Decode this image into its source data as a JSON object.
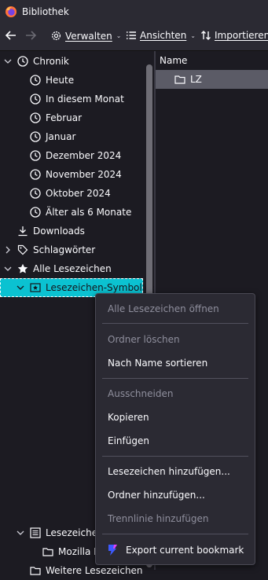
{
  "window": {
    "title": "Bibliothek"
  },
  "toolbar": {
    "back_label": "←",
    "forward_label": "→",
    "manage_label": "Verwalten",
    "views_label": "Ansichten",
    "import_label": "Importieren"
  },
  "tree": {
    "history": "Chronik",
    "history_items": [
      "Heute",
      "In diesem Monat",
      "Februar",
      "Januar",
      "Dezember 2024",
      "November 2024",
      "Oktober 2024",
      "Älter als 6 Monate"
    ],
    "downloads": "Downloads",
    "tags": "Schlagwörter",
    "all_bookmarks": "Alle Lesezeichen",
    "toolbar_folder": "Lesezeichen-Symbolleiste",
    "menu_folder": "Lesezeichen-Menü",
    "mozilla_folder": "Mozilla Firefox",
    "other_bookmarks": "Weitere Lesezeichen"
  },
  "list": {
    "column_name": "Name",
    "rows": [
      {
        "name": "LZ"
      }
    ]
  },
  "context_menu": {
    "open_all": "Alle Lesezeichen öffnen",
    "delete_folder": "Ordner löschen",
    "sort_by_name": "Nach Name sortieren",
    "cut": "Ausschneiden",
    "copy": "Kopieren",
    "paste": "Einfügen",
    "add_bookmark": "Lesezeichen hinzufügen...",
    "add_folder": "Ordner hinzufügen...",
    "add_separator": "Trennlinie hinzufügen",
    "export_bookmark": "Export current bookmark"
  },
  "colors": {
    "selection": "#0bc2d1",
    "list_selection": "#5b5b66",
    "background": "#1c1b22",
    "toolbar": "#2b2a33"
  }
}
